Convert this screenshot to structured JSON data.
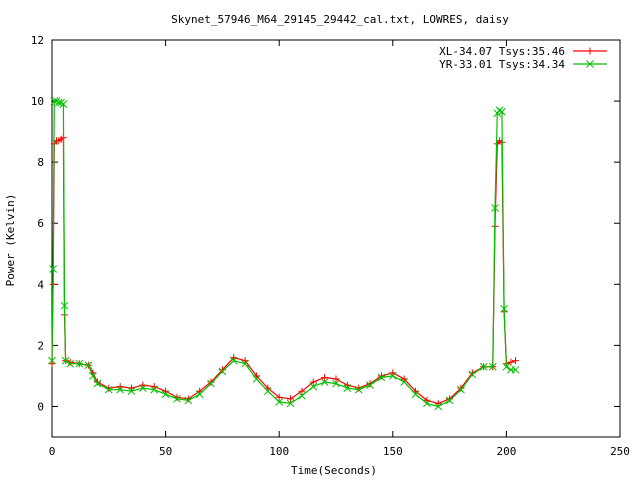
{
  "chart_data": {
    "type": "line",
    "title": "Skynet_57946_M64_29145_29442_cal.txt, LOWRES, daisy",
    "xlabel": "Time(Seconds)",
    "ylabel": "Power (Kelvin)",
    "xlim": [
      0,
      250
    ],
    "ylim": [
      -1,
      12
    ],
    "xticks": [
      0,
      50,
      100,
      150,
      200,
      250
    ],
    "yticks": [
      0,
      2,
      4,
      6,
      8,
      10,
      12
    ],
    "grid": false,
    "legend_position": "top-right",
    "series": [
      {
        "name": "XL-34.07 Tsys:35.46",
        "color": "#ff0000",
        "marker": "plus",
        "x": [
          0,
          0.5,
          1,
          2,
          3,
          4,
          5,
          5.5,
          6,
          8,
          12,
          16,
          18,
          20,
          25,
          30,
          35,
          40,
          45,
          50,
          55,
          60,
          65,
          70,
          75,
          80,
          85,
          90,
          95,
          100,
          105,
          110,
          115,
          120,
          125,
          130,
          135,
          140,
          145,
          150,
          155,
          160,
          165,
          170,
          175,
          180,
          185,
          190,
          194,
          195,
          196,
          197,
          198,
          199,
          200,
          202,
          204
        ],
        "y": [
          1.4,
          4.0,
          8.6,
          8.7,
          8.7,
          8.75,
          8.8,
          3.0,
          1.5,
          1.45,
          1.4,
          1.35,
          1.1,
          0.8,
          0.6,
          0.65,
          0.6,
          0.7,
          0.65,
          0.5,
          0.3,
          0.25,
          0.5,
          0.8,
          1.2,
          1.6,
          1.5,
          1.0,
          0.6,
          0.3,
          0.25,
          0.5,
          0.8,
          0.95,
          0.9,
          0.7,
          0.6,
          0.75,
          1.0,
          1.1,
          0.9,
          0.5,
          0.2,
          0.1,
          0.25,
          0.6,
          1.1,
          1.3,
          1.3,
          5.9,
          8.6,
          8.7,
          8.65,
          3.1,
          1.4,
          1.45,
          1.5
        ]
      },
      {
        "name": "YR-33.01 Tsys:34.34",
        "color": "#00c000",
        "marker": "cross",
        "x": [
          0,
          0.5,
          1,
          2,
          3,
          4,
          5,
          5.5,
          6,
          8,
          12,
          16,
          18,
          20,
          25,
          30,
          35,
          40,
          45,
          50,
          55,
          60,
          65,
          70,
          75,
          80,
          85,
          90,
          95,
          100,
          105,
          110,
          115,
          120,
          125,
          130,
          135,
          140,
          145,
          150,
          155,
          160,
          165,
          170,
          175,
          180,
          185,
          190,
          194,
          195,
          196,
          197,
          198,
          199,
          200,
          202,
          204
        ],
        "y": [
          1.5,
          4.5,
          10.0,
          10.0,
          9.95,
          9.95,
          9.9,
          3.3,
          1.5,
          1.4,
          1.4,
          1.35,
          1.0,
          0.75,
          0.55,
          0.55,
          0.5,
          0.6,
          0.55,
          0.4,
          0.25,
          0.2,
          0.4,
          0.75,
          1.15,
          1.5,
          1.4,
          0.9,
          0.5,
          0.15,
          0.1,
          0.35,
          0.65,
          0.8,
          0.75,
          0.6,
          0.55,
          0.7,
          0.95,
          1.0,
          0.8,
          0.4,
          0.1,
          0.0,
          0.2,
          0.55,
          1.05,
          1.3,
          1.3,
          6.5,
          9.6,
          9.7,
          9.65,
          3.2,
          1.3,
          1.2,
          1.2
        ]
      }
    ]
  }
}
